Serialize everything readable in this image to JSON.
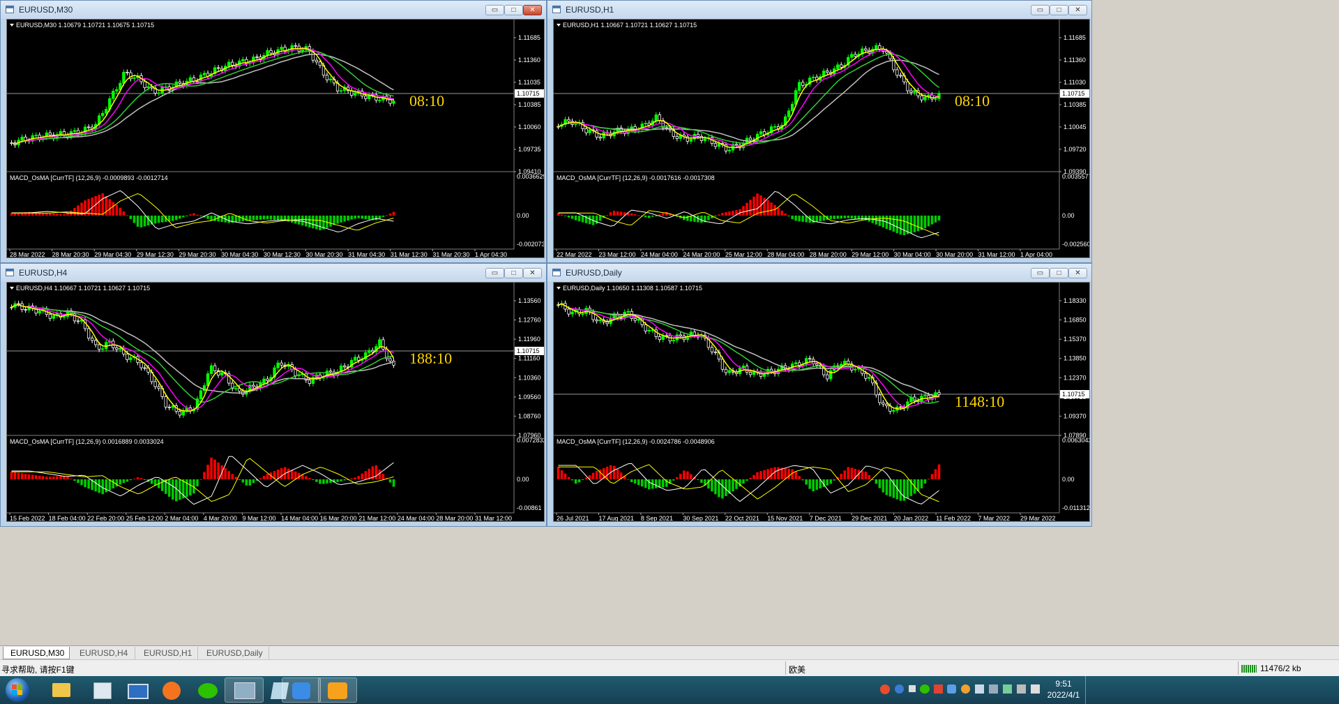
{
  "windows": [
    {
      "id": "m30",
      "title": "EURUSD,M30",
      "info": "EURUSD,M30  1.10679 1.10721 1.10675 1.10715",
      "price_scale": [
        "1.11685",
        "1.11360",
        "1.11035",
        "1.10385",
        "1.10060",
        "1.09735",
        "1.09410"
      ],
      "current_price": "1.10715",
      "countdown": "08:10",
      "indicator_label": "MACD_OsMA [CurrTF] (12,26,9) -0.0009893 -0.0012714",
      "indicator_scale": [
        "0.0036629",
        "0.00",
        "-0.002073"
      ],
      "time_axis": [
        "28 Mar 2022",
        "28 Mar 20:30",
        "29 Mar 04:30",
        "29 Mar 12:30",
        "29 Mar 20:30",
        "30 Mar 04:30",
        "30 Mar 12:30",
        "30 Mar 20:30",
        "31 Mar 04:30",
        "31 Mar 12:30",
        "31 Mar 20:30",
        "1 Apr 04:30"
      ]
    },
    {
      "id": "h1",
      "title": "EURUSD,H1",
      "info": "EURUSD,H1  1.10667 1.10721 1.10627 1.10715",
      "price_scale": [
        "1.11685",
        "1.11360",
        "1.11030",
        "1.10385",
        "1.10045",
        "1.09720",
        "1.09390"
      ],
      "current_price": "1.10715",
      "countdown": "08:10",
      "indicator_label": "MACD_OsMA [CurrTF] (12,26,9) -0.0017616 -0.0017308",
      "indicator_scale": [
        "0.0035577",
        "0.00",
        "-0.002560"
      ],
      "time_axis": [
        "22 Mar 2022",
        "23 Mar 12:00",
        "24 Mar 04:00",
        "24 Mar 20:00",
        "25 Mar 12:00",
        "28 Mar 04:00",
        "28 Mar 20:00",
        "29 Mar 12:00",
        "30 Mar 04:00",
        "30 Mar 20:00",
        "31 Mar 12:00",
        "1 Apr 04:00"
      ]
    },
    {
      "id": "h4",
      "title": "EURUSD,H4",
      "info": "EURUSD,H4  1.10667 1.10721 1.10627 1.10715",
      "price_scale": [
        "1.13560",
        "1.12760",
        "1.11960",
        "1.11160",
        "1.10360",
        "1.09560",
        "1.08760",
        "1.07960"
      ],
      "current_price": "1.10715",
      "countdown": "188:10",
      "indicator_label": "MACD_OsMA [CurrTF] (12,26,9) 0.0016889 0.0033024",
      "indicator_scale": [
        "0.0072832",
        "0.00",
        "-0.00861"
      ],
      "time_axis": [
        "15 Feb 2022",
        "18 Feb 04:00",
        "22 Feb 20:00",
        "25 Feb 12:00",
        "2 Mar 04:00",
        "4 Mar 20:00",
        "9 Mar 12:00",
        "14 Mar 04:00",
        "16 Mar 20:00",
        "21 Mar 12:00",
        "24 Mar 04:00",
        "28 Mar 20:00",
        "31 Mar 12:00"
      ]
    },
    {
      "id": "daily",
      "title": "EURUSD,Daily",
      "info": "EURUSD,Daily  1.10650 1.11308 1.10587 1.10715",
      "price_scale": [
        "1.18330",
        "1.16850",
        "1.15370",
        "1.13850",
        "1.12370",
        "1.10715",
        "1.09370",
        "1.07890"
      ],
      "current_price": "1.10715",
      "countdown": "1148:10",
      "indicator_label": "MACD_OsMA [CurrTF] (12,26,9) -0.0024786 -0.0048906",
      "indicator_scale": [
        "0.0063042",
        "0.00",
        "-0.011312"
      ],
      "time_axis": [
        "26 Jul 2021",
        "17 Aug 2021",
        "8 Sep 2021",
        "30 Sep 2021",
        "22 Oct 2021",
        "15 Nov 2021",
        "7 Dec 2021",
        "29 Dec 2021",
        "20 Jan 2022",
        "11 Feb 2022",
        "7 Mar 2022",
        "29 Mar 2022"
      ]
    }
  ],
  "tabs": [
    "EURUSD,M30",
    "EURUSD,H4",
    "EURUSD,H1",
    "EURUSD,Daily"
  ],
  "status": {
    "help": "寻求帮助, 请按F1键",
    "profile": "欧美",
    "traffic": "11476/2 kb"
  },
  "taskbar": {
    "time": "9:51",
    "date": "2022/4/1"
  },
  "colors": {
    "bull_candle": "#00ff00",
    "bear_candle": "#ffffff",
    "ma_fast": "#ffff00",
    "ma_mid": "#ff00ff",
    "ma_slow": "#32cd32",
    "ma_long": "#c0c0c0",
    "hist_up": "#ff0000",
    "hist_down": "#00cc00",
    "countdown": "#ffd700"
  }
}
